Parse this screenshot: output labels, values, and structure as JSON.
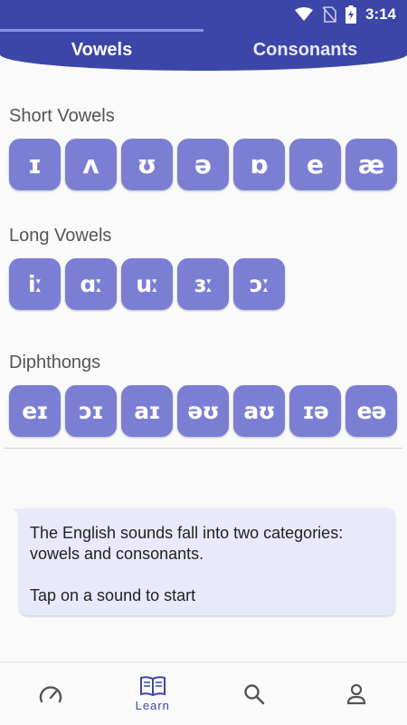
{
  "status_bar": {
    "time": "3:14",
    "icons": [
      "wifi-icon",
      "no-sim-icon",
      "battery-charging-icon"
    ]
  },
  "tabs": [
    {
      "label": "Vowels",
      "selected": true
    },
    {
      "label": "Consonants",
      "selected": false
    }
  ],
  "sections": {
    "short": {
      "title": "Short Vowels",
      "sounds": [
        "ɪ",
        "ʌ",
        "ʊ",
        "ə",
        "ɒ",
        "e",
        "æ"
      ]
    },
    "long": {
      "title": "Long Vowels",
      "sounds": [
        "iː",
        "ɑː",
        "uː",
        "ɜː",
        "ɔː"
      ]
    },
    "diphthongs": {
      "title": "Diphthongs",
      "sounds": [
        "eɪ",
        "ɔɪ",
        "aɪ",
        "əʊ",
        "aʊ",
        "ɪə",
        "eə"
      ]
    }
  },
  "info": {
    "line1": "The English sounds fall into two categories: vowels and consonants.",
    "line2": "Tap on a sound to start"
  },
  "bottom_nav": [
    {
      "icon": "speedometer-icon",
      "label": ""
    },
    {
      "icon": "book-icon",
      "label": "Learn"
    },
    {
      "icon": "search-icon",
      "label": ""
    },
    {
      "icon": "person-icon",
      "label": ""
    }
  ],
  "colors": {
    "primary": "#3b46a8",
    "key": "#7b7fd4",
    "card": "#e8e9fb"
  }
}
